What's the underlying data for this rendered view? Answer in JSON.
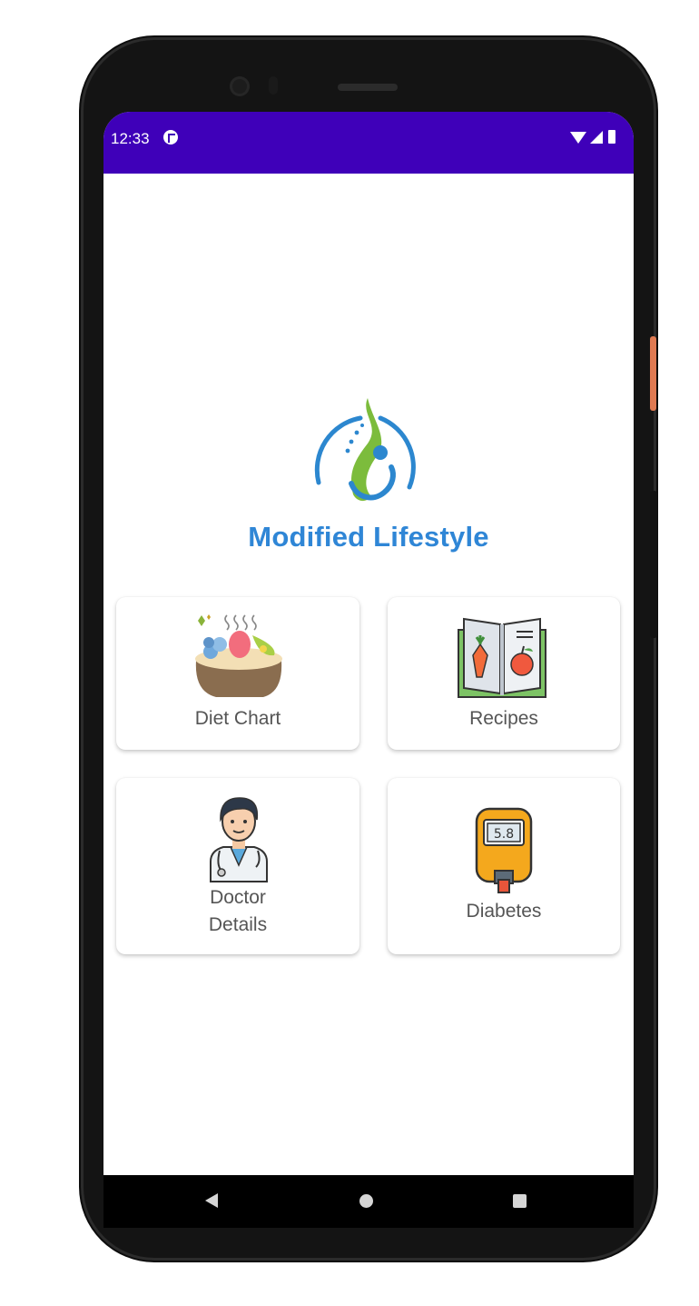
{
  "status_bar": {
    "time": "12:33",
    "color": "#3f00b9",
    "icons": [
      "notification-p-icon",
      "wifi-icon",
      "signal-icon",
      "battery-icon"
    ]
  },
  "app": {
    "title": "Modified Lifestyle",
    "title_color": "#2f86d6"
  },
  "menu": {
    "items": [
      {
        "label": "Diet Chart",
        "icon": "fruit-tart-icon"
      },
      {
        "label": "Recipes",
        "icon": "recipe-book-icon"
      },
      {
        "label_line1": "Doctor",
        "label_line2": "Details",
        "icon": "doctor-icon"
      },
      {
        "label": "Diabetes",
        "icon": "glucometer-icon"
      }
    ]
  },
  "glucometer_reading": "5.8",
  "nav_bar": {
    "buttons": [
      "back-icon",
      "home-icon",
      "recents-icon"
    ]
  }
}
